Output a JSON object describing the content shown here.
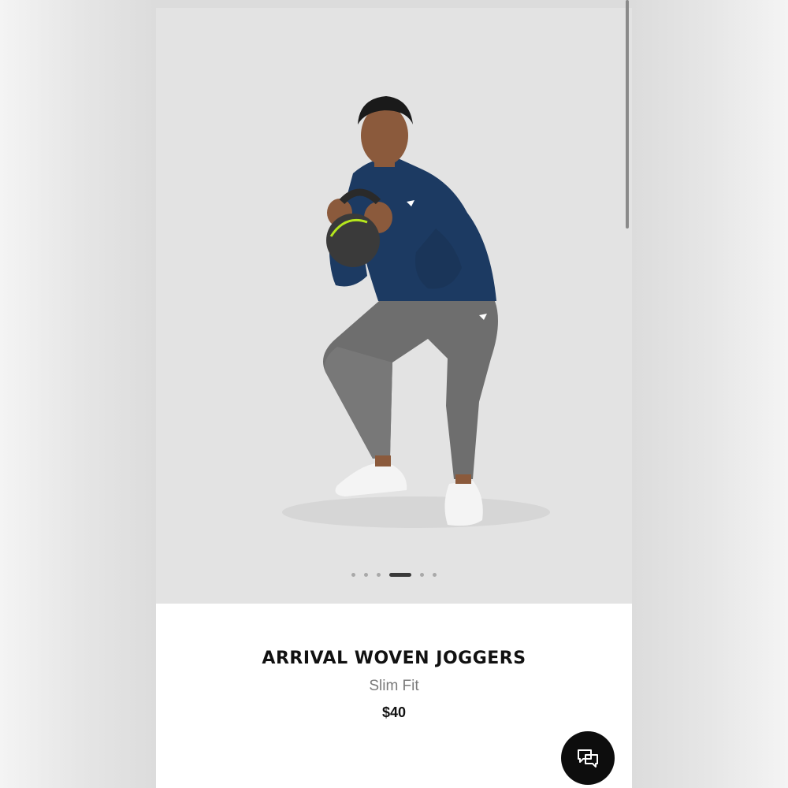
{
  "product": {
    "title": "ARRIVAL WOVEN JOGGERS",
    "fit": "Slim Fit",
    "price": "$40"
  },
  "carousel": {
    "total_images": 6,
    "active_index": 4
  },
  "chat": {
    "icon": "chat-bubbles-icon"
  },
  "colors": {
    "image_background": "#e3e3e3",
    "shirt_navy": "#1c3a62",
    "joggers_grey": "#6e6e6e",
    "kettlebell_accent": "#b5e61d",
    "chat_button_bg": "#0d0d0d"
  }
}
